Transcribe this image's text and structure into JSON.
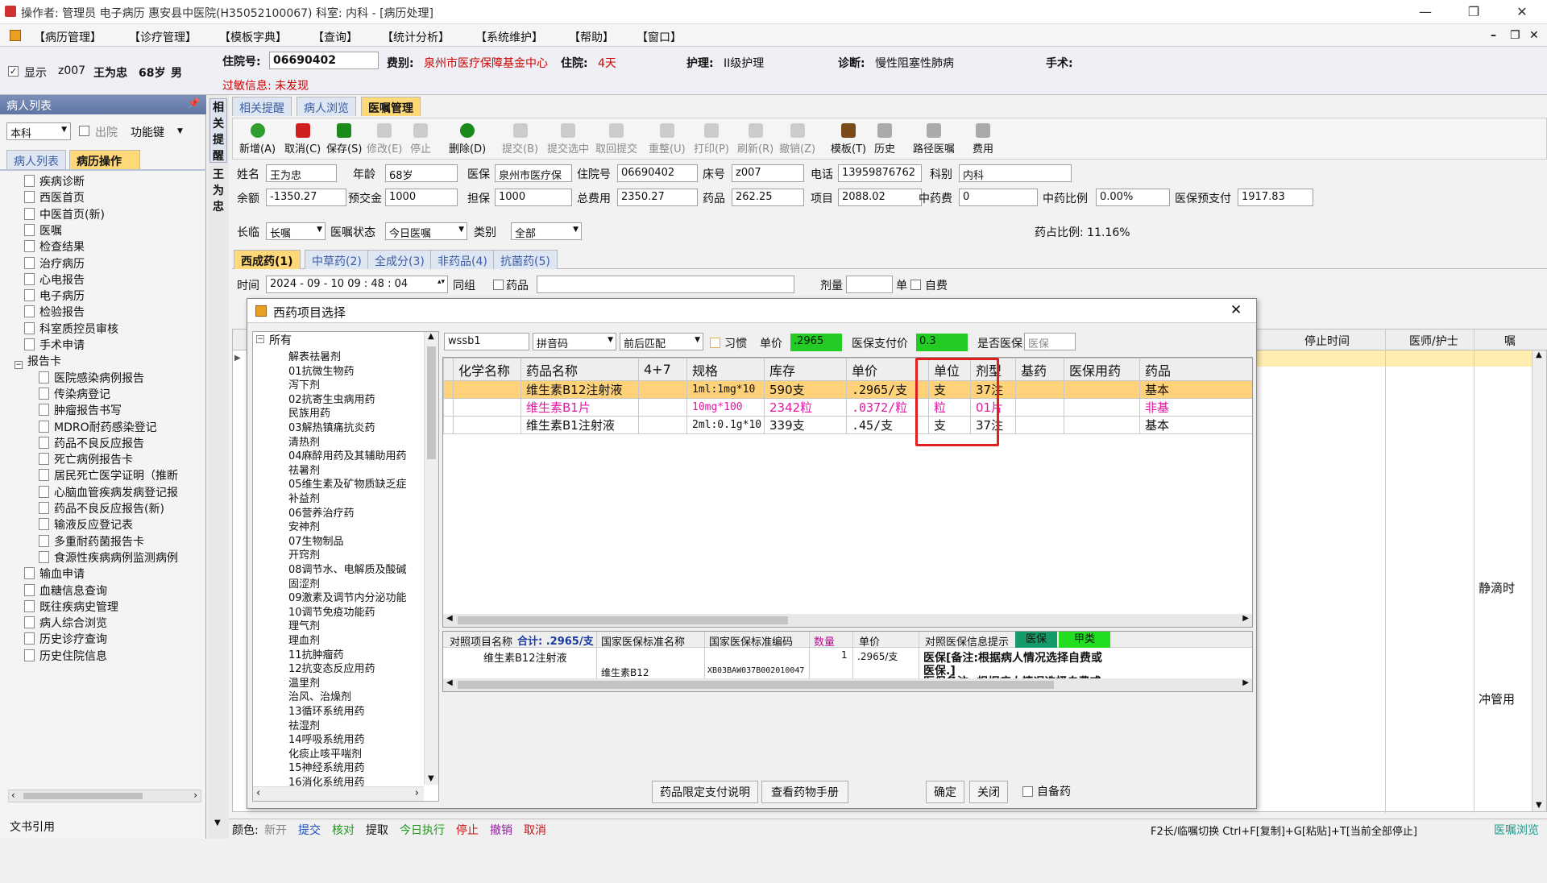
{
  "titlebar": {
    "title": "操作者: 管理员 电子病历 惠安县中医院(H35052100067) 科室: 内科 - [病历处理]",
    "min": "—",
    "restore": "❐",
    "close": "✕"
  },
  "menu": [
    "【病历管理】",
    "【诊疗管理】",
    "【模板字典】",
    "【查询】",
    "【统计分析】",
    "【系统维护】",
    "【帮助】",
    "【窗口】"
  ],
  "menu_right": [
    "–",
    "❐",
    "✕"
  ],
  "patient": {
    "display_label": "显示",
    "bed": "z007",
    "name": "王为忠",
    "age": "68岁",
    "sex": "男",
    "admission_no_label": "住院号:",
    "admission_no": "06690402",
    "fee_type_label": "费别:",
    "fee_type": "泉州市医疗保障基金中心",
    "stay_label": "住院:",
    "stay": "4天",
    "nursing_label": "护理:",
    "nursing": "II级护理",
    "diagnosis_label": "诊断:",
    "diagnosis": "慢性阻塞性肺病",
    "surgery_label": "手术:",
    "allergy": "过敏信息: 未发现"
  },
  "left": {
    "header": "病人列表",
    "dept": "本科",
    "discharge": "出院",
    "func_key": "功能键",
    "tabs": [
      "病人列表",
      "病历操作"
    ],
    "tree": [
      {
        "label": "疾病诊断",
        "level": 1
      },
      {
        "label": "西医首页",
        "level": 1
      },
      {
        "label": "中医首页(新)",
        "level": 1
      },
      {
        "label": "医嘱",
        "level": 1
      },
      {
        "label": "检查结果",
        "level": 1
      },
      {
        "label": "治疗病历",
        "level": 1
      },
      {
        "label": "心电报告",
        "level": 1
      },
      {
        "label": "电子病历",
        "level": 1
      },
      {
        "label": "检验报告",
        "level": 1
      },
      {
        "label": "科室质控员审核",
        "level": 1
      },
      {
        "label": "手术申请",
        "level": 1
      },
      {
        "label": "报告卡",
        "level": 0
      },
      {
        "label": "医院感染病例报告",
        "level": 2
      },
      {
        "label": "传染病登记",
        "level": 2
      },
      {
        "label": "肿瘤报告书写",
        "level": 2
      },
      {
        "label": "MDRO耐药感染登记",
        "level": 2
      },
      {
        "label": "药品不良反应报告",
        "level": 2
      },
      {
        "label": "死亡病例报告卡",
        "level": 2
      },
      {
        "label": "居民死亡医学证明（推断",
        "level": 2
      },
      {
        "label": "心脑血管疾病发病登记报",
        "level": 2
      },
      {
        "label": "药品不良反应报告(新)",
        "level": 2
      },
      {
        "label": "输液反应登记表",
        "level": 2
      },
      {
        "label": "多重耐药菌报告卡",
        "level": 2
      },
      {
        "label": "食源性疾病病例监测病例",
        "level": 2
      },
      {
        "label": "输血申请",
        "level": 1
      },
      {
        "label": "血糖信息查询",
        "level": 1
      },
      {
        "label": "既往疾病史管理",
        "level": 1
      },
      {
        "label": "病人综合浏览",
        "level": 1
      },
      {
        "label": "历史诊疗查询",
        "level": 1
      },
      {
        "label": "历史住院信息",
        "level": 1
      }
    ],
    "doc_ref": "文书引用"
  },
  "vstrip": [
    "相",
    "关",
    "提",
    "醒",
    "王",
    "为",
    "忠"
  ],
  "main_tabs": [
    "相关提醒",
    "病人浏览",
    "医嘱管理"
  ],
  "toolbar": [
    {
      "label": "新增(A)",
      "icon": "add-icon",
      "color": "#2e9e2e",
      "enabled": true
    },
    {
      "label": "取消(C)",
      "icon": "undo-icon",
      "color": "#d02020",
      "enabled": true
    },
    {
      "label": "保存(S)",
      "icon": "save-icon",
      "color": "#1a8a1a",
      "enabled": true
    },
    {
      "label": "修改(E)",
      "icon": "edit-icon",
      "color": "#aaaaaa",
      "enabled": false
    },
    {
      "label": "停止",
      "icon": "stop-icon",
      "color": "#aaaaaa",
      "enabled": false
    },
    {
      "label": "删除(D)",
      "icon": "delete-icon",
      "color": "#1a8a1a",
      "enabled": true
    },
    {
      "label": "提交(B)",
      "icon": "submit-icon",
      "color": "#aaaaaa",
      "enabled": false
    },
    {
      "label": "提交选中",
      "icon": "submit-selected-icon",
      "color": "#aaaaaa",
      "enabled": false
    },
    {
      "label": "取回提交",
      "icon": "retrieve-icon",
      "color": "#aaaaaa",
      "enabled": false
    },
    {
      "label": "重整(U)",
      "icon": "reorganize-icon",
      "color": "#aaaaaa",
      "enabled": false
    },
    {
      "label": "打印(P)",
      "icon": "print-icon",
      "color": "#aaaaaa",
      "enabled": false
    },
    {
      "label": "刷新(R)",
      "icon": "refresh-icon",
      "color": "#aaaaaa",
      "enabled": false
    },
    {
      "label": "撤销(Z)",
      "icon": "revoke-icon",
      "color": "#aaaaaa",
      "enabled": false
    },
    {
      "label": "模板(T)",
      "icon": "template-icon",
      "color": "#7a4a1a",
      "enabled": true
    },
    {
      "label": "历史",
      "icon": "history-icon",
      "color": "#aaaaaa",
      "enabled": true
    },
    {
      "label": "路径医嘱",
      "icon": "pathway-icon",
      "color": "#aaaaaa",
      "enabled": true
    },
    {
      "label": "费用",
      "icon": "fee-icon",
      "color": "#aaaaaa",
      "enabled": true
    }
  ],
  "info1": {
    "name_l": "姓名",
    "name": "王为忠",
    "age_l": "年龄",
    "age": "68岁",
    "ins_l": "医保",
    "ins": "泉州市医疗保",
    "adm_l": "住院号",
    "adm": "06690402",
    "bed_l": "床号",
    "bed": "z007",
    "phone_l": "电话",
    "phone": "13959876762",
    "dept_l": "科别",
    "dept": "内科"
  },
  "info2": {
    "bal_l": "余额",
    "bal": "-1350.27",
    "pre_l": "预交金",
    "pre": "1000",
    "guar_l": "担保",
    "guar": "1000",
    "total_l": "总费用",
    "total": "2350.27",
    "drug_l": "药品",
    "drug": "262.25",
    "item_l": "项目",
    "item": "2088.02",
    "tcm_l": "中药费",
    "tcm": "0",
    "tcm_ratio_l": "中药比例",
    "tcm_ratio": "0.00%",
    "ins_pre_l": "医保预支付",
    "ins_pre": "1917.83"
  },
  "filter": {
    "type_l": "长临",
    "type": "长嘱",
    "status_l": "医嘱状态",
    "status": "今日医嘱",
    "cat_l": "类别",
    "cat": "全部",
    "ratio": "药占比例: 11.16%"
  },
  "drug_tabs": [
    "西成药(1)",
    "中草药(2)",
    "全成分(3)",
    "非药品(4)",
    "抗菌药(5)"
  ],
  "time_row": {
    "time_l": "时间",
    "time": "2024 - 09 - 10   09 : 48 : 04",
    "group": "同组",
    "drug_chk": "药品",
    "dose": "剂量",
    "unit": "单",
    "selfpay": "自费"
  },
  "bg_grid": {
    "cols": [
      "停止时间",
      "医师/护士",
      "嘱"
    ],
    "side": [
      "静滴时",
      "冲管用"
    ]
  },
  "dialog": {
    "title": "西药项目选择",
    "close": "✕",
    "tree_root": "所有",
    "tree": [
      "解表祛暑剂",
      "01抗微生物药",
      "泻下剂",
      "02抗寄生虫病用药",
      "民族用药",
      "03解热镇痛抗炎药",
      "清热剂",
      "04麻醉用药及其辅助用药",
      "祛暑剂",
      "05维生素及矿物质缺乏症",
      "补益剂",
      "06营养治疗药",
      "安神剂",
      "07生物制品",
      "开窍剂",
      "08调节水、电解质及酸碱",
      "固涩剂",
      "09激素及调节内分泌功能",
      "10调节免疫功能药",
      "理气剂",
      "理血剂",
      "11抗肿瘤药",
      "12抗变态反应用药",
      "温里剂",
      "治风、治燥剂",
      "13循环系统用药",
      "祛湿剂",
      "14呼吸系统用药",
      "化痰止咳平喘剂",
      "15神经系统用药",
      "16消化系统用药",
      "消导剂"
    ],
    "search": "wssb1",
    "method": "拼音码",
    "match": "前后匹配",
    "habit": "习惯",
    "price_l": "单价",
    "price": ".2965",
    "ins_pay_l": "医保支付价",
    "ins_pay": "0.3",
    "is_ins_l": "是否医保",
    "is_ins": "医保",
    "columns": [
      "化学名称",
      "药品名称",
      "4+7",
      "规格",
      "库存",
      "单价",
      "单位",
      "剂型",
      "基药",
      "医保用药",
      "药品"
    ],
    "rows": [
      [
        "",
        "维生素B12注射液",
        "",
        "1ml:1mg*10",
        "590支",
        ".2965/支",
        "支",
        "37注",
        "",
        "",
        "基本"
      ],
      [
        "",
        "维生素B1片",
        "",
        "10mg*100",
        "2342粒",
        ".0372/粒",
        "粒",
        "01片",
        "",
        "",
        "非基"
      ],
      [
        "",
        "维生素B1注射液",
        "",
        "2ml:0.1g*10",
        "339支",
        ".45/支",
        "支",
        "37注",
        "",
        "",
        "基本"
      ]
    ],
    "bottom_cols": {
      "item_name": "对照项目名称",
      "sum": "合计: .2965/支",
      "std_name": "国家医保标准名称",
      "std_code": "国家医保标准编码",
      "qty": "数量",
      "unit_price": "单价",
      "hint": "对照医保信息提示",
      "ins_tag": "医保",
      "class_tag": "甲类"
    },
    "bottom_row": {
      "item": "维生素B12注射液",
      "std_name": "维生素B12",
      "std_code": "XB03BAW037B002010047",
      "qty": "1",
      "price": ".2965/支",
      "hint1": "医保[备注:根据病人情况选择自费或",
      "hint2": "医保.]",
      "hint3": "医保备注: 根据病人情况选择自费或"
    },
    "btn_limit": "药品限定支付说明",
    "btn_manual": "查看药物手册",
    "btn_ok": "确定",
    "btn_close": "关闭",
    "self_drug": "自备药"
  },
  "status": {
    "color_l": "颜色:",
    "tags": [
      {
        "t": "新开",
        "c": "#888888"
      },
      {
        "t": "提交",
        "c": "#2050c0"
      },
      {
        "t": "核对",
        "c": "#1a9a1a"
      },
      {
        "t": "提取",
        "c": "#111111"
      },
      {
        "t": "今日执行",
        "c": "#1a9a1a"
      },
      {
        "t": "停止",
        "c": "#d01010"
      },
      {
        "t": "撤销",
        "c": "#9020a0"
      },
      {
        "t": "取消",
        "c": "#d01010"
      }
    ],
    "hint": "F2长/临嘱切换 Ctrl+F[复制]+G[粘贴]+T[当前全部停止]",
    "browse": "医嘱浏览"
  }
}
